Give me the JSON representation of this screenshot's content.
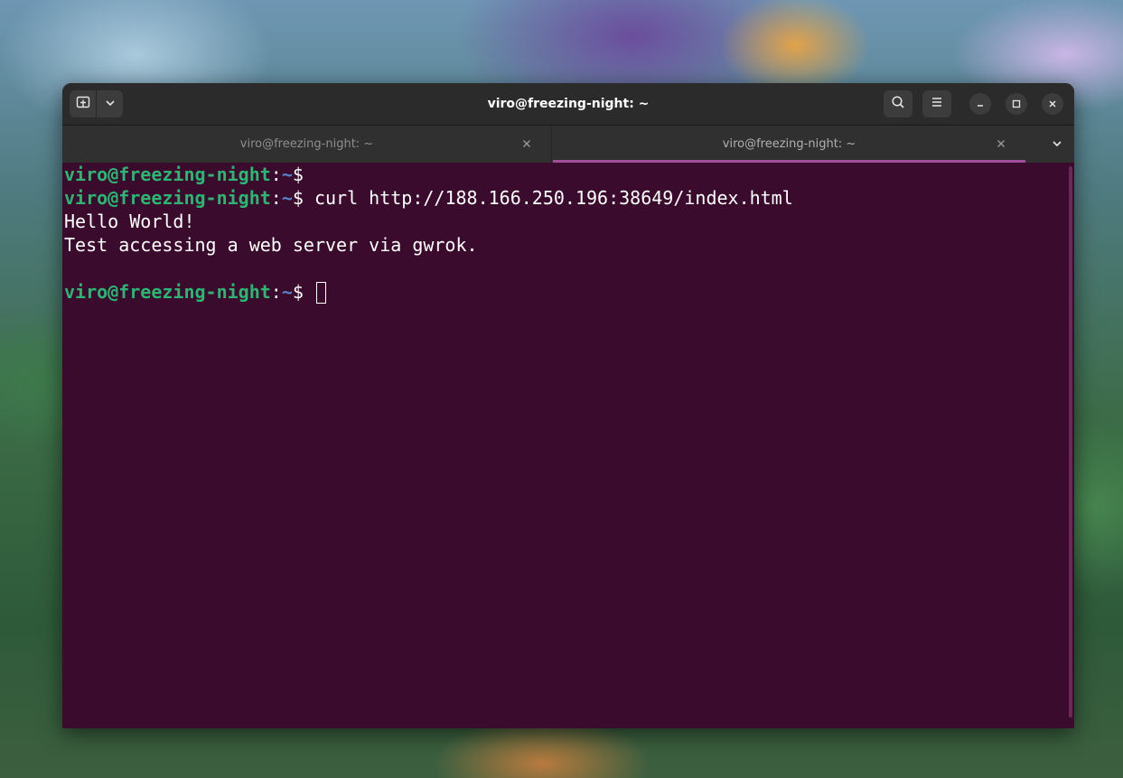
{
  "window": {
    "title": "viro@freezing-night: ~"
  },
  "headerbar": {
    "new_tab_icon": "new-tab-icon",
    "dropdown_icon": "chevron-down-icon",
    "search_icon": "search-icon",
    "menu_icon": "hamburger-menu-icon",
    "minimize_icon": "minimize-icon",
    "maximize_icon": "maximize-icon",
    "close_icon": "close-icon"
  },
  "tabs": [
    {
      "label": "viro@freezing-night: ~",
      "active": false
    },
    {
      "label": "viro@freezing-night: ~",
      "active": true
    }
  ],
  "terminal": {
    "prompt_user": "viro@freezing-night",
    "prompt_colon": ":",
    "prompt_path": "~",
    "prompt_symbol": "$",
    "lines": [
      {
        "type": "prompt",
        "command": ""
      },
      {
        "type": "prompt",
        "command": " curl http://188.166.250.196:38649/index.html"
      },
      {
        "type": "output",
        "text": "Hello World!"
      },
      {
        "type": "output",
        "text": "Test accessing a web server via gwrok."
      },
      {
        "type": "blank",
        "text": ""
      },
      {
        "type": "prompt",
        "command": " "
      }
    ]
  },
  "colors": {
    "terminal_bg": "#3b0b2d",
    "prompt_user": "#2bb673",
    "prompt_path": "#5a80c8",
    "tab_accent": "#a24e9c",
    "headerbar_bg": "#2b2b2b"
  }
}
